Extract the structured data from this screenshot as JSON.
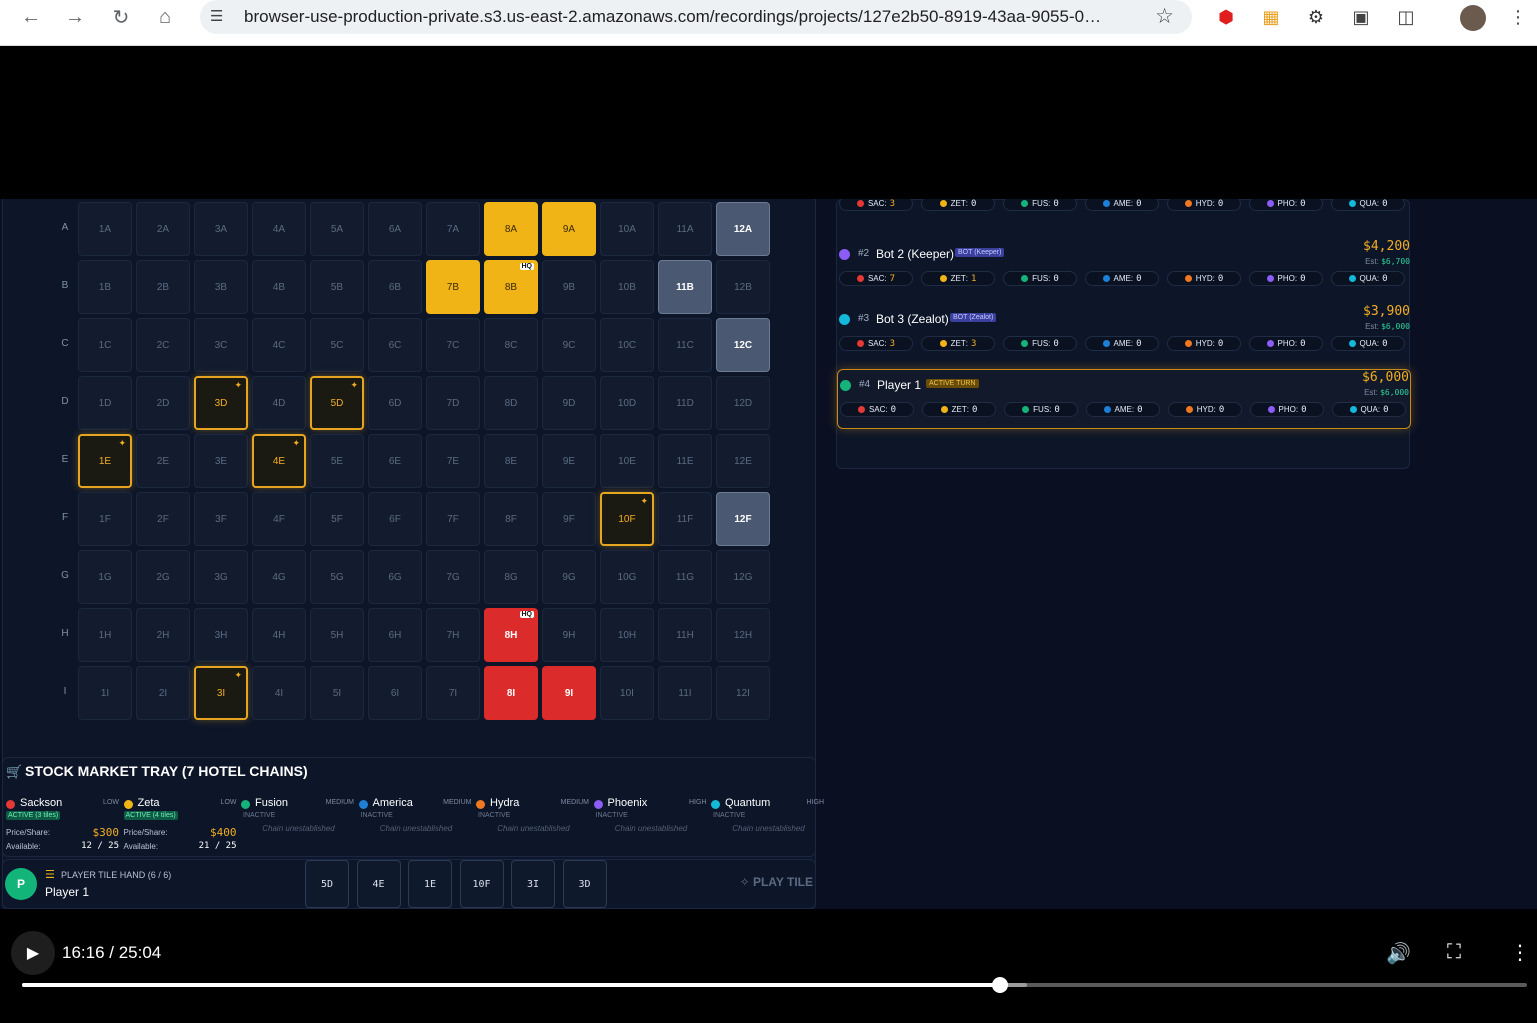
{
  "browser": {
    "url": "browser-use-production-private.s3.us-east-2.amazonaws.com/recordings/projects/127e2b50-8919-43aa-9055-0…"
  },
  "board": {
    "columns": [
      "1",
      "2",
      "3",
      "4",
      "5",
      "6",
      "7",
      "8",
      "9",
      "10",
      "11",
      "12"
    ],
    "rows": [
      "A",
      "B",
      "C",
      "D",
      "E",
      "F",
      "G",
      "H",
      "I"
    ],
    "cells": {
      "8A": {
        "kind": "yellow"
      },
      "9A": {
        "kind": "yellow"
      },
      "12A": {
        "kind": "gray"
      },
      "7B": {
        "kind": "yellow"
      },
      "8B": {
        "kind": "yellow",
        "hq": "HQ"
      },
      "11B": {
        "kind": "gray"
      },
      "12C": {
        "kind": "gray"
      },
      "3D": {
        "kind": "hand"
      },
      "5D": {
        "kind": "hand"
      },
      "1E": {
        "kind": "hand"
      },
      "4E": {
        "kind": "hand"
      },
      "10F": {
        "kind": "hand"
      },
      "12F": {
        "kind": "gray"
      },
      "8H": {
        "kind": "red",
        "hq": "HQ"
      },
      "3I": {
        "kind": "hand"
      },
      "8I": {
        "kind": "red"
      },
      "9I": {
        "kind": "red"
      }
    }
  },
  "tray": {
    "title": "STOCK MARKET TRAY (7 HOTEL CHAINS)",
    "chains": [
      {
        "name": "Sackson",
        "tier": "LOW",
        "color": "#e53935",
        "status": "ACTIVE (3 tiles)",
        "active": true,
        "price_label": "Price/Share:",
        "price": "$300",
        "avail_label": "Available:",
        "avail": "12 / 25"
      },
      {
        "name": "Zeta",
        "tier": "LOW",
        "color": "#f0b417",
        "status": "ACTIVE (4 tiles)",
        "active": true,
        "price_label": "Price/Share:",
        "price": "$400",
        "avail_label": "Available:",
        "avail": "21 / 25"
      },
      {
        "name": "Fusion",
        "tier": "MEDIUM",
        "color": "#15b37a",
        "status": "INACTIVE",
        "active": false,
        "note": "Chain unestablished"
      },
      {
        "name": "America",
        "tier": "MEDIUM",
        "color": "#1e7fd6",
        "status": "INACTIVE",
        "active": false,
        "note": "Chain unestablished"
      },
      {
        "name": "Hydra",
        "tier": "MEDIUM",
        "color": "#f07820",
        "status": "INACTIVE",
        "active": false,
        "note": "Chain unestablished"
      },
      {
        "name": "Phoenix",
        "tier": "HIGH",
        "color": "#8b5cf6",
        "status": "INACTIVE",
        "active": false,
        "note": "Chain unestablished"
      },
      {
        "name": "Quantum",
        "tier": "HIGH",
        "color": "#14b8d9",
        "status": "INACTIVE",
        "active": false,
        "note": "Chain unestablished"
      }
    ]
  },
  "hand": {
    "avatar": "P",
    "label": "PLAYER TILE HAND (6 / 6)",
    "player": "Player 1",
    "tiles": [
      "5D",
      "4E",
      "1E",
      "10F",
      "3I",
      "3D"
    ],
    "play_label": "PLAY TILE"
  },
  "players": {
    "top_est": "Est: $6,000",
    "rows": [
      {
        "rank": "",
        "name": "",
        "badge": "",
        "cash": "",
        "est": "",
        "color": "",
        "active": false,
        "holdings": [
          [
            "SAC",
            "3"
          ],
          [
            "ZET",
            "0"
          ],
          [
            "FUS",
            "0"
          ],
          [
            "AME",
            "0"
          ],
          [
            "HYD",
            "0"
          ],
          [
            "PHO",
            "0"
          ],
          [
            "QUA",
            "0"
          ]
        ]
      },
      {
        "rank": "#2",
        "name": "Bot 2 (Keeper)",
        "badge": "BOT (Keeper)",
        "badge_kind": "bot",
        "cash": "$4,200",
        "est_label": "Est:",
        "est": "$6,700",
        "color": "#8b5cf6",
        "active": false,
        "holdings": [
          [
            "SAC",
            "7"
          ],
          [
            "ZET",
            "1"
          ],
          [
            "FUS",
            "0"
          ],
          [
            "AME",
            "0"
          ],
          [
            "HYD",
            "0"
          ],
          [
            "PHO",
            "0"
          ],
          [
            "QUA",
            "0"
          ]
        ]
      },
      {
        "rank": "#3",
        "name": "Bot 3 (Zealot)",
        "badge": "BOT (Zealot)",
        "badge_kind": "bot",
        "cash": "$3,900",
        "est_label": "Est:",
        "est": "$6,000",
        "color": "#14b8d9",
        "active": false,
        "holdings": [
          [
            "SAC",
            "3"
          ],
          [
            "ZET",
            "3"
          ],
          [
            "FUS",
            "0"
          ],
          [
            "AME",
            "0"
          ],
          [
            "HYD",
            "0"
          ],
          [
            "PHO",
            "0"
          ],
          [
            "QUA",
            "0"
          ]
        ]
      },
      {
        "rank": "#4",
        "name": "Player 1",
        "badge": "ACTIVE TURN",
        "badge_kind": "turn",
        "cash": "$6,000",
        "est_label": "Est:",
        "est": "$6,000",
        "color": "#15b37a",
        "active": true,
        "holdings": [
          [
            "SAC",
            "0"
          ],
          [
            "ZET",
            "0"
          ],
          [
            "FUS",
            "0"
          ],
          [
            "AME",
            "0"
          ],
          [
            "HYD",
            "0"
          ],
          [
            "PHO",
            "0"
          ],
          [
            "QUA",
            "0"
          ]
        ]
      }
    ],
    "holding_colors": {
      "SAC": "#e53935",
      "ZET": "#f0b417",
      "FUS": "#15b37a",
      "AME": "#1e7fd6",
      "HYD": "#f07820",
      "PHO": "#8b5cf6",
      "QUA": "#14b8d9"
    }
  },
  "video": {
    "time": "16:16 / 25:04",
    "progress_fraction": 0.65,
    "buffer_fraction": 0.668
  }
}
